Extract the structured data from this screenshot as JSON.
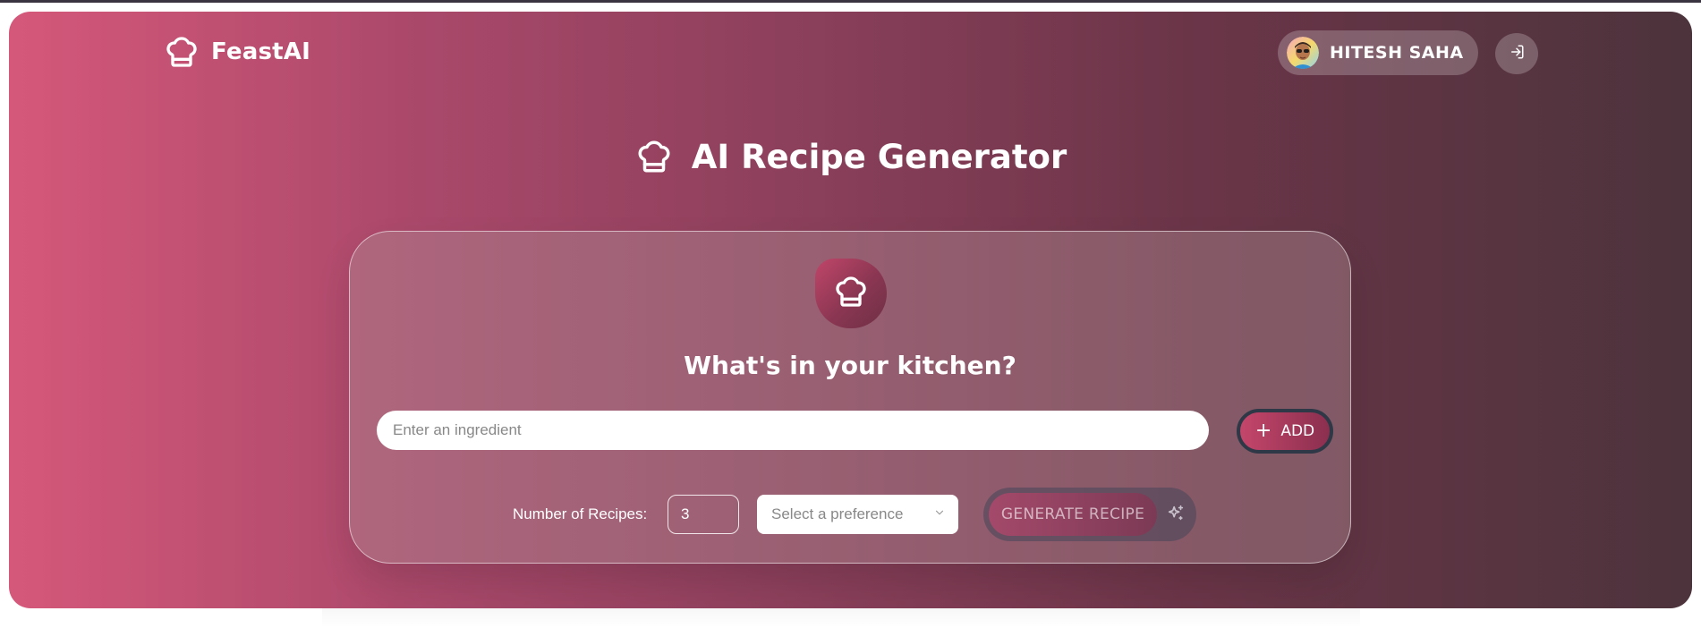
{
  "app": {
    "brand_name": "FeastAI"
  },
  "header": {
    "user_name": "HITESH SAHA"
  },
  "main": {
    "page_title": "AI Recipe Generator",
    "card_heading": "What's in your kitchen?",
    "ingredient_placeholder": "Enter an ingredient",
    "add_label": "ADD",
    "num_recipes_label": "Number of Recipes:",
    "num_recipes_value": "3",
    "preference_placeholder": "Select a preference",
    "generate_label": "GENERATE RECIPE"
  },
  "icons": {
    "brand": "chef-hat-icon",
    "title": "chef-hat-icon",
    "card": "chef-hat-icon",
    "logout": "logout-icon",
    "add": "plus-icon",
    "dropdown": "chevron-down-icon",
    "generate": "sparkles-icon"
  },
  "colors": {
    "gradient_start": "#d5587a",
    "gradient_end": "#4c333c",
    "accent": "#c4466b"
  }
}
